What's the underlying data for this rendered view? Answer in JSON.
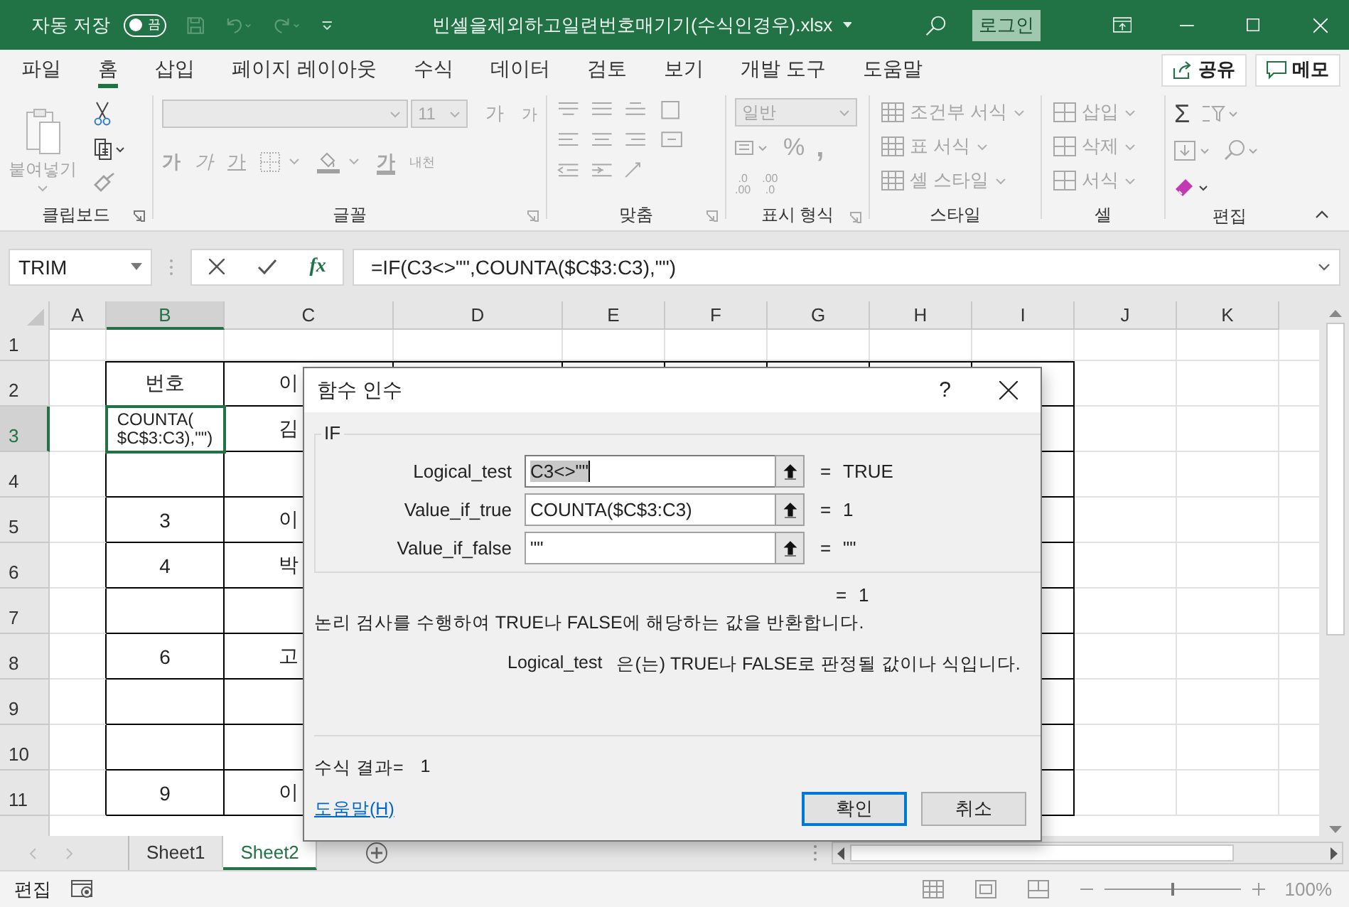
{
  "title_bar": {
    "autosave_label": "자동 저장",
    "autosave": {
      "on": false,
      "label": "끔"
    },
    "title": "빈셀을제외하고일련번호매기기(수식인경우).xlsx",
    "signin": "로그인"
  },
  "tabs": [
    {
      "label": "파일",
      "selected": false
    },
    {
      "label": "홈",
      "selected": true
    },
    {
      "label": "삽입",
      "selected": false
    },
    {
      "label": "페이지 레이아웃",
      "selected": false
    },
    {
      "label": "수식",
      "selected": false
    },
    {
      "label": "데이터",
      "selected": false
    },
    {
      "label": "검토",
      "selected": false
    },
    {
      "label": "보기",
      "selected": false
    },
    {
      "label": "개발 도구",
      "selected": false
    },
    {
      "label": "도움말",
      "selected": false
    }
  ],
  "share": "공유",
  "comment": "메모",
  "ribbon": {
    "clipboard": {
      "label": "클립보드",
      "launcher": true,
      "paste": "붙여넣기"
    },
    "font": {
      "label": "글꼴",
      "launcher": true,
      "size": "11",
      "buttons": [
        {
          "text": "가",
          "kind": "grow"
        },
        {
          "text": "가",
          "kind": "shrink"
        }
      ],
      "styles": [
        {
          "text": "가",
          "kind": "bold"
        },
        {
          "text": "가",
          "kind": "italic"
        },
        {
          "text": "가",
          "kind": "underline"
        }
      ],
      "font_color": "가",
      "phonetic": "내천"
    },
    "alignment": {
      "label": "맞춤",
      "launcher": true
    },
    "number": {
      "label": "표시 형식",
      "launcher": true,
      "format": "일반",
      "percent": "%",
      "comma": ",",
      "increase": [
        ".0",
        ".00"
      ],
      "decrease": [
        ".00",
        ".0"
      ]
    },
    "styles": {
      "label": "스타일",
      "items": [
        "조건부 서식",
        "표 서식",
        "셀 스타일"
      ]
    },
    "cells": {
      "label": "셀",
      "items": [
        "삽입",
        "삭제",
        "서식"
      ]
    },
    "editing": {
      "label": "편집",
      "sum": "Σ"
    }
  },
  "formula_bar": {
    "name_box": "TRIM",
    "fx": "fx",
    "formula": "=IF(C3<>\"\",COUNTA($C$3:C3),\"\")"
  },
  "columns": [
    {
      "label": "A",
      "selected": false
    },
    {
      "label": "B",
      "selected": true
    },
    {
      "label": "C",
      "selected": false
    },
    {
      "label": "D",
      "selected": false
    },
    {
      "label": "E",
      "selected": false
    },
    {
      "label": "F",
      "selected": false
    },
    {
      "label": "G",
      "selected": false
    },
    {
      "label": "H",
      "selected": false
    },
    {
      "label": "I",
      "selected": false
    },
    {
      "label": "J",
      "selected": false
    },
    {
      "label": "K",
      "selected": false
    }
  ],
  "rows": [
    {
      "header": "1",
      "selected": false,
      "bordered": false
    },
    {
      "header": "2",
      "selected": false,
      "bordered": true,
      "b": "번호",
      "c": "이"
    },
    {
      "header": "3",
      "selected": true,
      "bordered": true,
      "b_lines": [
        "COUNTA(",
        "$C$3:C3),\"\")"
      ],
      "c": "김"
    },
    {
      "header": "4",
      "selected": false,
      "bordered": true
    },
    {
      "header": "5",
      "selected": false,
      "bordered": true,
      "b": "3",
      "c": "이"
    },
    {
      "header": "6",
      "selected": false,
      "bordered": true,
      "b": "4",
      "c": "박"
    },
    {
      "header": "7",
      "selected": false,
      "bordered": true
    },
    {
      "header": "8",
      "selected": false,
      "bordered": true,
      "b": "6",
      "c": "고"
    },
    {
      "header": "9",
      "selected": false,
      "bordered": true
    },
    {
      "header": "10",
      "selected": false,
      "bordered": true
    },
    {
      "header": "11",
      "selected": false,
      "bordered": true,
      "b": "9",
      "c": "이"
    }
  ],
  "dialog": {
    "title": "함수 인수",
    "help_glyph": "?",
    "function": "IF",
    "args": [
      {
        "label": "Logical_test",
        "value": "C3<>\"\"",
        "equals": "=",
        "result": "TRUE",
        "focused": true
      },
      {
        "label": "Value_if_true",
        "value": "COUNTA($C$3:C3)",
        "equals": "=",
        "result": "1",
        "focused": false
      },
      {
        "label": "Value_if_false",
        "value": "\"\"",
        "equals": "=",
        "result": "\"\"",
        "focused": false
      }
    ],
    "total_equals": "=",
    "total": "1",
    "description": "논리 검사를 수행하여 TRUE나 FALSE에 해당하는 값을 반환합니다.",
    "arg_name": "Logical_test",
    "arg_description": "은(는) TRUE나 FALSE로 판정될 값이나 식입니다.",
    "result_label": "수식 결과=",
    "result": "1",
    "help_link": "도움말(H)",
    "buttons": [
      {
        "label": "확인",
        "default": true
      },
      {
        "label": "취소",
        "default": false
      }
    ]
  },
  "sheets": [
    {
      "label": "Sheet1",
      "selected": false
    },
    {
      "label": "Sheet2",
      "selected": true
    }
  ],
  "status_bar": {
    "mode": "편집",
    "zoom": {
      "label": "100%",
      "level": 0.5
    }
  }
}
